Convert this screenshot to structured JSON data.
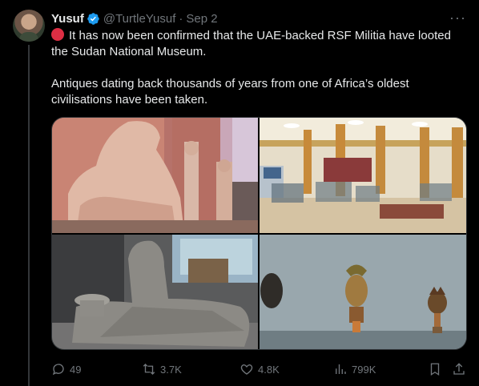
{
  "author": {
    "name": "Yusuf",
    "handle": "@TurtleYusuf",
    "date": "Sep 2"
  },
  "tweet": {
    "line1": "It has now been confirmed that the UAE-backed RSF Militia have looted the Sudan National Museum.",
    "line2": "Antiques dating back thousands of years from one of Africa’s oldest civilisations have been taken."
  },
  "actions": {
    "replies": "49",
    "reposts": "3.7K",
    "likes": "4.8K",
    "views": "799K"
  },
  "colors": {
    "background": "#000000",
    "text": "#e7e9ea",
    "muted": "#71767b",
    "verified": "#1d9bf0",
    "red_circle": "#dd2e44"
  },
  "icons": [
    "verified-badge-icon",
    "more-icon",
    "red-circle-icon",
    "reply-icon",
    "repost-icon",
    "like-icon",
    "views-icon",
    "bookmark-icon",
    "share-icon"
  ]
}
